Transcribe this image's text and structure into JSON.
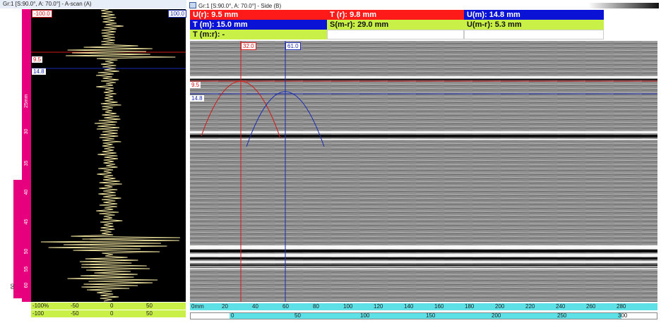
{
  "ascan": {
    "title": "Gr:1 [S:90.0°, A: 70.0°] - A-scan (A)",
    "amp_min": "-100.0",
    "amp_max": "100.0",
    "gate_u_label": "9.5",
    "gate_m_label": "14.8",
    "vertical_ruler": [
      "25mm",
      "30",
      "35",
      "40",
      "45",
      "50",
      "55",
      "60"
    ],
    "left_strip_label": "60",
    "h_ruler_top": [
      "-100%",
      "-50",
      "0",
      "50"
    ],
    "h_ruler_bottom": [
      "-100",
      "-50",
      "0",
      "50"
    ]
  },
  "side": {
    "title": "Gr:1 [S:90.0°, A: 70.0°] - Side (B)",
    "readings": {
      "u_r": "U(r): 9.5 mm",
      "t_r": "T (r): 9.8 mm",
      "u_m": "U(m): 14.8 mm",
      "t_m": "T (m): 15.0 mm",
      "s_mr": "S(m-r): 29.0 mm",
      "u_mr": "U(m-r): 5.3 mm",
      "t_mr": "T (m:r): -"
    },
    "cursor_r_label": "32.0",
    "cursor_m_label": "61.0",
    "gate_u_label": "9.5",
    "gate_m_label": "14.8",
    "h_ruler_top": [
      "0mm",
      "20",
      "40",
      "60",
      "80",
      "100",
      "120",
      "140",
      "160",
      "180",
      "200",
      "220",
      "240",
      "260",
      "280"
    ],
    "h_ruler_bottom": [
      "0",
      "50",
      "100",
      "150",
      "200",
      "250",
      "300"
    ]
  },
  "colors": {
    "reference": "#ff1a1a",
    "measure": "#0a12d6",
    "difference": "#c8f046",
    "ruler": "#e6007e",
    "scan_axis": "#5de0e6"
  },
  "icons": {
    "side_window_icon": "window-icon"
  }
}
